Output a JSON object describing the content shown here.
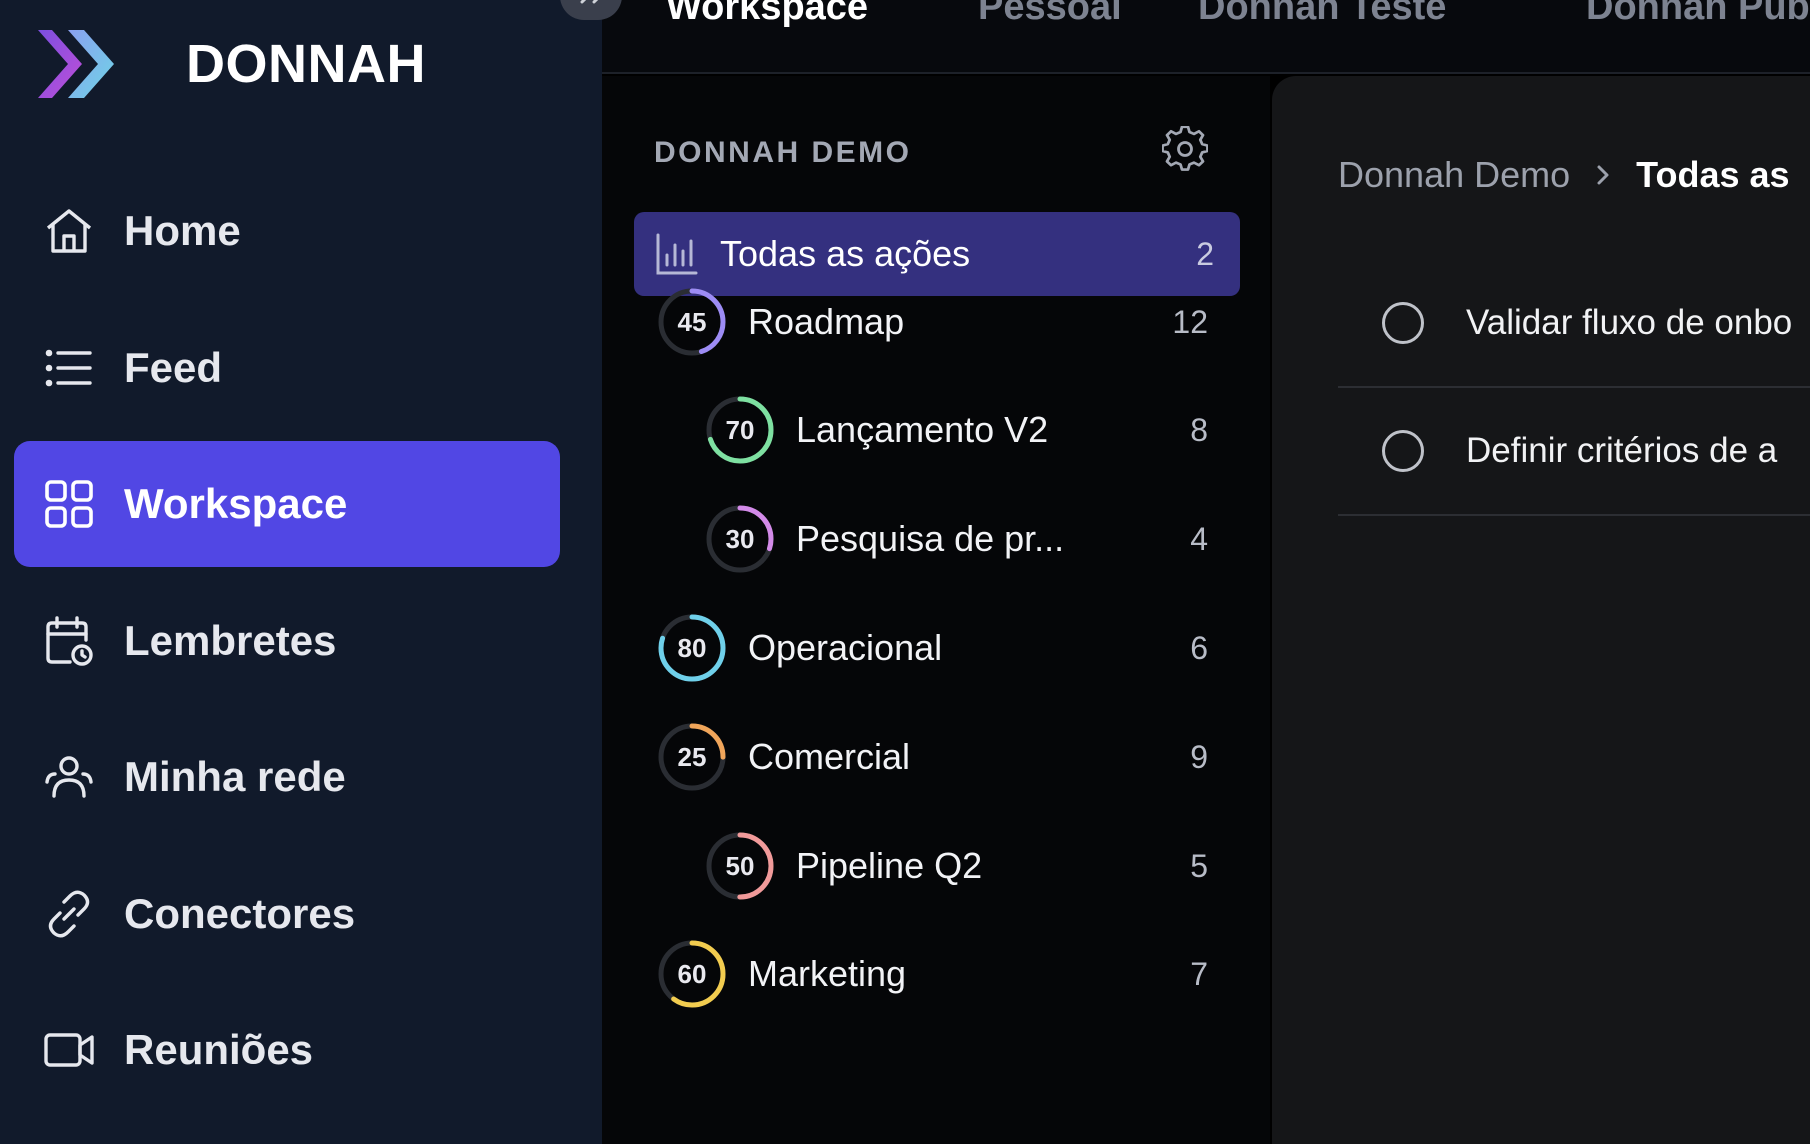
{
  "brand": {
    "name": "DONNAH",
    "icon": "double-chevron-logo-icon"
  },
  "colors": {
    "sidebar_bg": "#111a2b",
    "accent": "#5147e4",
    "selected_list_bg": "#34307f",
    "panel_bg": "#050608",
    "content_bg": "#151618"
  },
  "sidebar": {
    "items": [
      {
        "label": "Home",
        "icon": "home-icon",
        "active": false
      },
      {
        "label": "Feed",
        "icon": "list-icon",
        "active": false
      },
      {
        "label": "Workspace",
        "icon": "grid-icon",
        "active": true
      },
      {
        "label": "Lembretes",
        "icon": "calendar-clock-icon",
        "active": false
      },
      {
        "label": "Minha rede",
        "icon": "people-icon",
        "active": false
      },
      {
        "label": "Conectores",
        "icon": "link-icon",
        "active": false
      },
      {
        "label": "Reuniões",
        "icon": "video-icon",
        "active": false
      }
    ]
  },
  "topbar": {
    "tabs": [
      {
        "label": "Workspace",
        "active": true
      },
      {
        "label": "Pessoal",
        "active": false
      },
      {
        "label": "Donnah Teste",
        "active": false
      },
      {
        "label": "Donnah Publ",
        "active": false
      }
    ]
  },
  "workspace_panel": {
    "title": "DONNAH DEMO",
    "all_actions": {
      "label": "Todas as ações",
      "count": "2"
    },
    "projects": [
      {
        "name": "Roadmap",
        "progress": 45,
        "count": "12",
        "color": "#9d8cf5",
        "level": 0
      },
      {
        "name": "Lançamento V2",
        "progress": 70,
        "count": "8",
        "color": "#7ee0a1",
        "level": 1
      },
      {
        "name": "Pesquisa de pr...",
        "progress": 30,
        "count": "4",
        "color": "#d38ae8",
        "level": 1
      },
      {
        "name": "Operacional",
        "progress": 80,
        "count": "6",
        "color": "#6fd0ea",
        "level": 0
      },
      {
        "name": "Comercial",
        "progress": 25,
        "count": "9",
        "color": "#f0a55a",
        "level": 0
      },
      {
        "name": "Pipeline Q2",
        "progress": 50,
        "count": "5",
        "color": "#f19a9a",
        "level": 1
      },
      {
        "name": "Marketing",
        "progress": 60,
        "count": "7",
        "color": "#f2cc4f",
        "level": 0
      }
    ]
  },
  "content": {
    "breadcrumb": {
      "parent": "Donnah Demo",
      "current": "Todas as"
    },
    "tasks": [
      {
        "label": "Validar fluxo de onbo"
      },
      {
        "label": "Definir critérios de a"
      }
    ]
  }
}
